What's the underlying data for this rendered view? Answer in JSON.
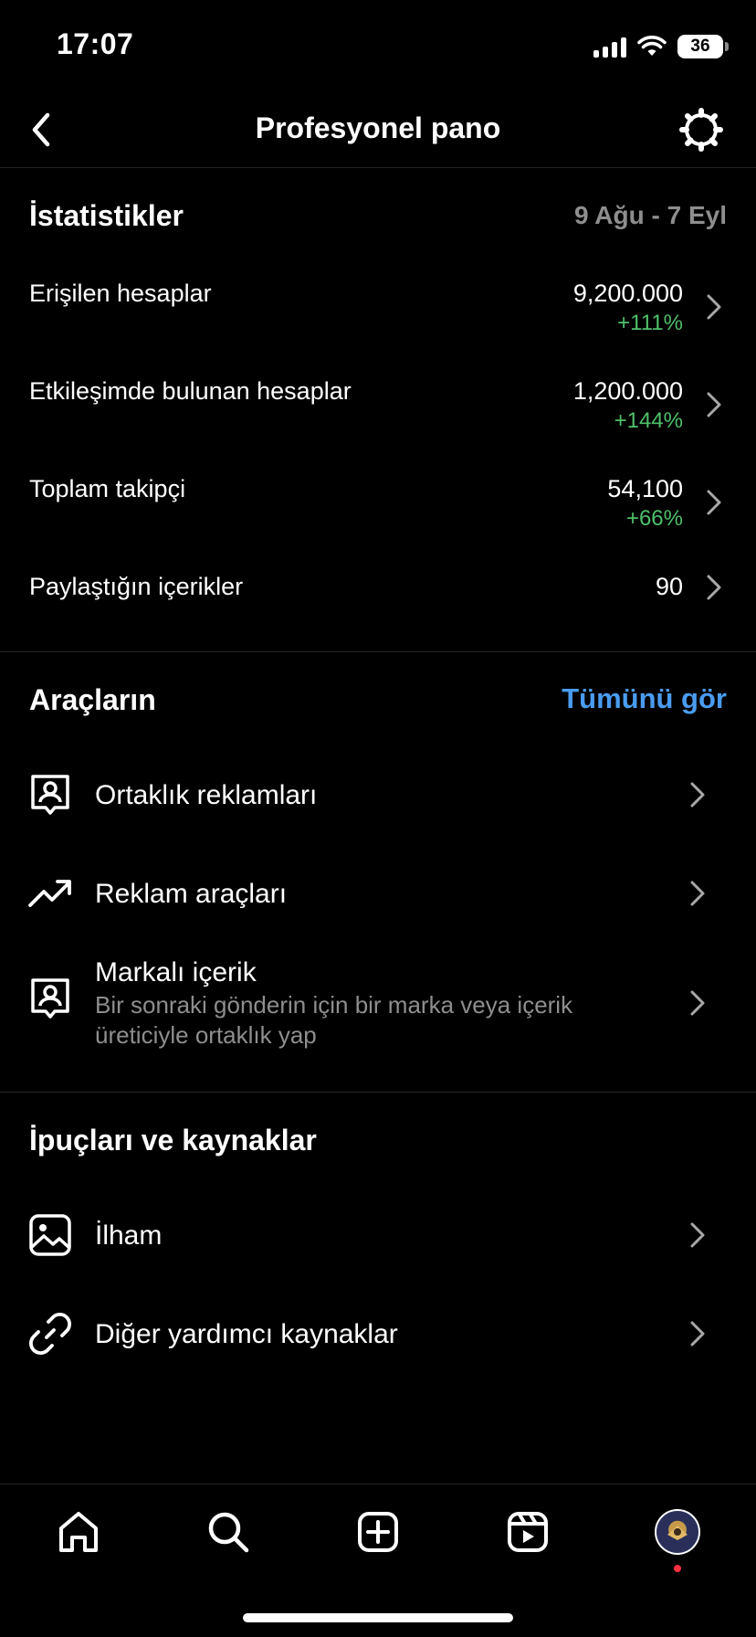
{
  "status_bar": {
    "time": "17:07",
    "battery": "36"
  },
  "header": {
    "title": "Profesyonel pano",
    "back_icon": "chevron-left-icon",
    "settings_icon": "gear-icon"
  },
  "stats": {
    "title": "İstatistikler",
    "date_range": "9 Ağu - 7 Eyl",
    "rows": [
      {
        "label": "Erişilen hesaplar",
        "value": "9,200.000",
        "change": "+111%"
      },
      {
        "label": "Etkileşimde bulunan hesaplar",
        "value": "1,200.000",
        "change": "+144%"
      },
      {
        "label": "Toplam takipçi",
        "value": "54,100",
        "change": "+66%"
      },
      {
        "label": "Paylaştığın içerikler",
        "value": "90",
        "change": ""
      }
    ]
  },
  "tools": {
    "title": "Araçların",
    "see_all": "Tümünü gör",
    "items": [
      {
        "label": "Ortaklık reklamları",
        "subtitle": "",
        "icon": "person-badge-icon"
      },
      {
        "label": "Reklam araçları",
        "subtitle": "",
        "icon": "trending-up-icon"
      },
      {
        "label": "Markalı içerik",
        "subtitle": "Bir sonraki gönderin için bir marka veya içerik üreticiyle ortaklık yap",
        "icon": "person-badge-icon"
      }
    ]
  },
  "resources": {
    "title": "İpuçları ve kaynaklar",
    "items": [
      {
        "label": "İlham",
        "icon": "image-icon"
      },
      {
        "label": "Diğer yardımcı kaynaklar",
        "icon": "link-icon"
      }
    ]
  },
  "tab_bar": {
    "items": [
      "home-icon",
      "search-icon",
      "add-post-icon",
      "reels-icon",
      "profile-avatar"
    ]
  },
  "colors": {
    "background": "#000000",
    "positive_change": "#4fbf6a",
    "link_blue": "#4a9cf0",
    "secondary_text": "#8e8e8e",
    "notification_dot": "#ff3040"
  }
}
